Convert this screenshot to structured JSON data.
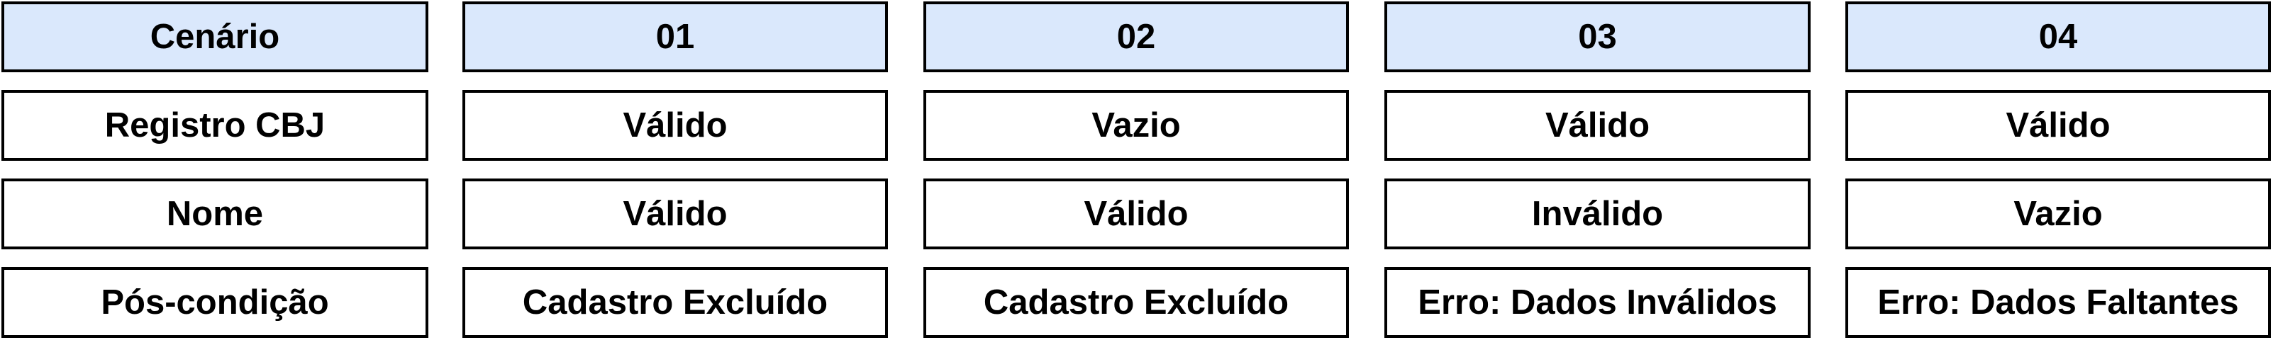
{
  "table": {
    "header": [
      "Cenário",
      "01",
      "02",
      "03",
      "04"
    ],
    "rows": [
      [
        "Registro CBJ",
        "Válido",
        "Vazio",
        "Válido",
        "Válido"
      ],
      [
        "Nome",
        "Válido",
        "Válido",
        "Inválido",
        "Vazio"
      ],
      [
        "Pós-condição",
        "Cadastro Excluído",
        "Cadastro Excluído",
        "Erro: Dados Inválidos",
        "Erro: Dados Faltantes"
      ]
    ]
  },
  "colors": {
    "header_fill": "#dae8fc",
    "cell_fill": "#ffffff",
    "border": "#000000"
  }
}
